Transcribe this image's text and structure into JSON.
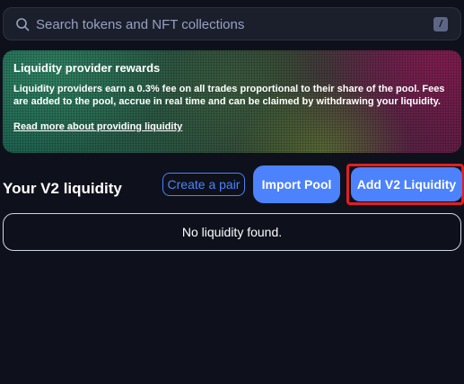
{
  "search": {
    "placeholder": "Search tokens and NFT collections",
    "shortcut": "/"
  },
  "banner": {
    "title": "Liquidity provider rewards",
    "text": "Liquidity providers earn a 0.3% fee on all trades proportional to their share of the pool. Fees are added to the pool, accrue in real time and can be claimed by withdrawing your liquidity.",
    "link": "Read more about providing liquidity"
  },
  "liquidity": {
    "heading": "Your V2 liquidity",
    "create_pair_label": "Create a pair",
    "import_pool_label": "Import Pool",
    "add_v2_label": "Add V2 Liquidity",
    "empty_message": "No liquidity found."
  },
  "colors": {
    "background": "#0e111b",
    "accent": "#4c82fb",
    "highlight_border": "#e01f22"
  }
}
